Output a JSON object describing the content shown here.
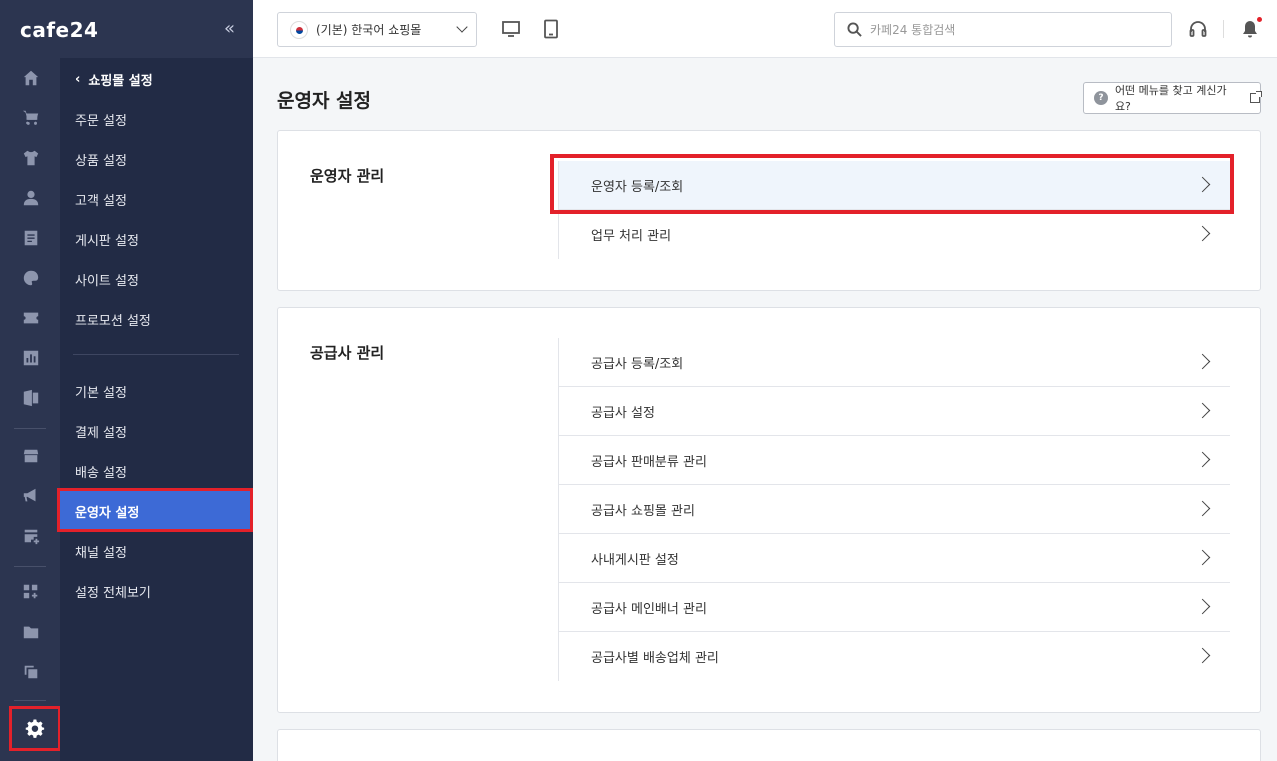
{
  "brand": {
    "logo": "cafe24",
    "collapse_label": "«"
  },
  "header": {
    "shop_select": "(기본) 한국어 쇼핑몰",
    "search_placeholder": "카페24 통합검색"
  },
  "submenu": {
    "back_label": "쇼핑몰 설정",
    "items": [
      "주문 설정",
      "상품 설정",
      "고객 설정",
      "게시판 설정",
      "사이트 설정",
      "프로모션 설정"
    ],
    "items2": [
      "기본 설정",
      "결제 설정",
      "배송 설정"
    ],
    "active": "운영자 설정",
    "items3": [
      "채널 설정",
      "설정 전체보기"
    ]
  },
  "main": {
    "title": "운영자 설정",
    "help_label": "어떤 메뉴를 찾고 계신가요?",
    "help_q": "?",
    "sections": [
      {
        "title": "운영자 관리",
        "items": [
          "운영자 등록/조회",
          "업무 처리 관리"
        ]
      },
      {
        "title": "공급사 관리",
        "items": [
          "공급사 등록/조회",
          "공급사 설정",
          "공급사 판매분류 관리",
          "공급사 쇼핑몰 관리",
          "사내게시판 설정",
          "공급사 메인배너 관리",
          "공급사별 배송업체 관리"
        ]
      }
    ]
  },
  "colors": {
    "rail": "#2c3550",
    "submenu": "#222b45",
    "active": "#3d6ad6",
    "highlight": "#e3212a"
  },
  "icons": [
    "home-icon",
    "cart-icon",
    "shirt-icon",
    "user-icon",
    "board-icon",
    "palette-icon",
    "coupon-icon",
    "chart-icon",
    "excel-icon",
    "store-icon",
    "megaphone-icon",
    "shop-add-icon",
    "apps-icon",
    "folder-icon",
    "copy-icon",
    "settings-icon"
  ]
}
